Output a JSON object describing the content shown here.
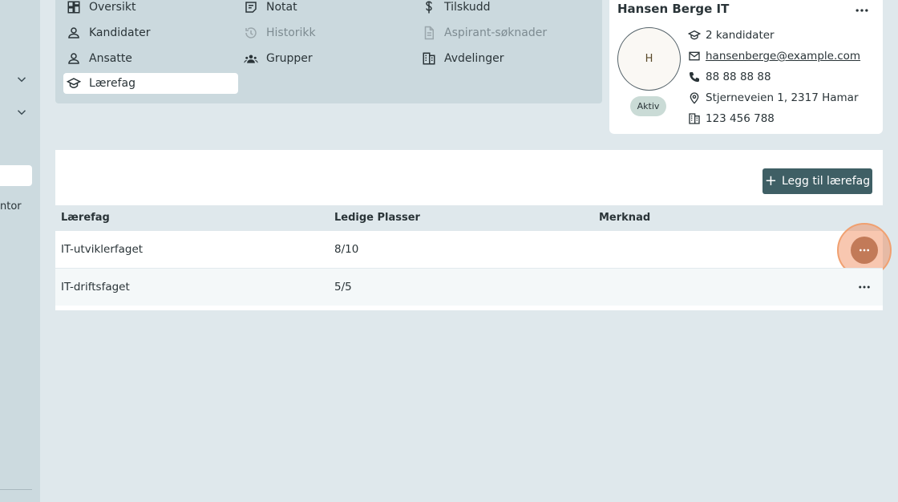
{
  "sidebar": {
    "partial_item_label": "ntor"
  },
  "nav": {
    "items": [
      {
        "label": "Oversikt",
        "icon": "dashboard-icon"
      },
      {
        "label": "Notat",
        "icon": "note-icon"
      },
      {
        "label": "Tilskudd",
        "icon": "dollar-icon"
      },
      {
        "label": "Kandidater",
        "icon": "person-icon"
      },
      {
        "label": "Historikk",
        "icon": "history-icon"
      },
      {
        "label": "Aspirant-søknader",
        "icon": "document-icon"
      },
      {
        "label": "Ansatte",
        "icon": "person-icon"
      },
      {
        "label": "Grupper",
        "icon": "groups-icon"
      },
      {
        "label": "Avdelinger",
        "icon": "building-icon"
      },
      {
        "label": "Lærefag",
        "icon": "school-icon"
      }
    ]
  },
  "company_card": {
    "title": "Hansen Berge IT",
    "avatar_letter": "H",
    "status": "Aktiv",
    "candidates": "2 kandidater",
    "email": "hansenberge@example.com",
    "phone": "88 88 88 88",
    "address": "Stjerneveien 1, 2317 Hamar",
    "org_number": "123 456 788"
  },
  "table": {
    "add_button_label": "Legg til lærefag",
    "columns": [
      "Lærefag",
      "Ledige Plasser",
      "Merknad"
    ],
    "rows": [
      {
        "subject": "IT-utviklerfaget",
        "available": "8/10",
        "note": ""
      },
      {
        "subject": "IT-driftsfaget",
        "available": "5/5",
        "note": ""
      }
    ]
  },
  "colors": {
    "page_bg": "#dfe8ec",
    "nav_panel_bg": "#cbd9de",
    "primary_button": "#3f5f65",
    "highlight": "#f0a070"
  }
}
